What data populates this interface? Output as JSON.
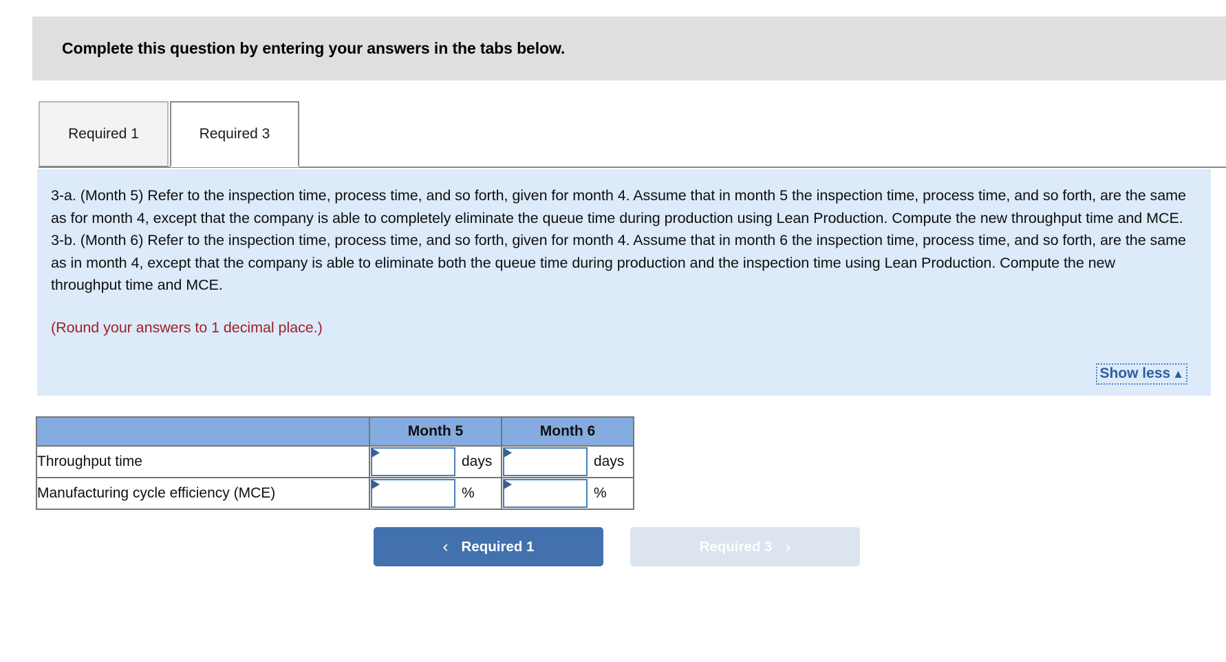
{
  "banner": {
    "title": "Complete this question by entering your answers in the tabs below."
  },
  "tabs": [
    {
      "label": "Required 1",
      "active": false
    },
    {
      "label": "Required 3",
      "active": true
    }
  ],
  "instructions": {
    "part_a": "3-a. (Month 5) Refer to the inspection time, process time, and so forth, given for month 4. Assume that in month 5 the inspection time, process time, and so forth, are the same as for month 4, except that the company is able to completely eliminate the queue time during production using Lean Production. Compute the new throughput time and MCE.",
    "part_b": "3-b. (Month 6) Refer to the inspection time, process time, and so forth, given for month 4. Assume that in month 6 the inspection time, process time, and so forth, are the same as in month 4, except that the company is able to eliminate both the queue time during production and the inspection time using Lean Production. Compute the new throughput time and MCE.",
    "note": "(Round your answers to 1 decimal place.)",
    "show_less_label": "Show less",
    "show_less_caret": "▲"
  },
  "answer_table": {
    "headers": [
      "",
      "Month 5",
      "Month 6"
    ],
    "rows": [
      {
        "label": "Throughput time",
        "month5": {
          "value": "",
          "unit": "days"
        },
        "month6": {
          "value": "",
          "unit": "days"
        }
      },
      {
        "label": "Manufacturing cycle efficiency (MCE)",
        "month5": {
          "value": "",
          "unit": "%"
        },
        "month6": {
          "value": "",
          "unit": "%"
        }
      }
    ]
  },
  "nav": {
    "prev_label": "Required 1",
    "prev_chevron": "‹",
    "next_label": "Required 3",
    "next_chevron": "›"
  },
  "colors": {
    "banner_bg": "#dfdfdf",
    "instructions_bg": "#dceafa",
    "note_red": "#9e2222",
    "table_header_blue": "#85abe0",
    "input_border_blue": "#4a7ebb",
    "primary_button": "#4271ad",
    "disabled_button": "#dbe4ef",
    "link_blue": "#2d5f9e"
  }
}
